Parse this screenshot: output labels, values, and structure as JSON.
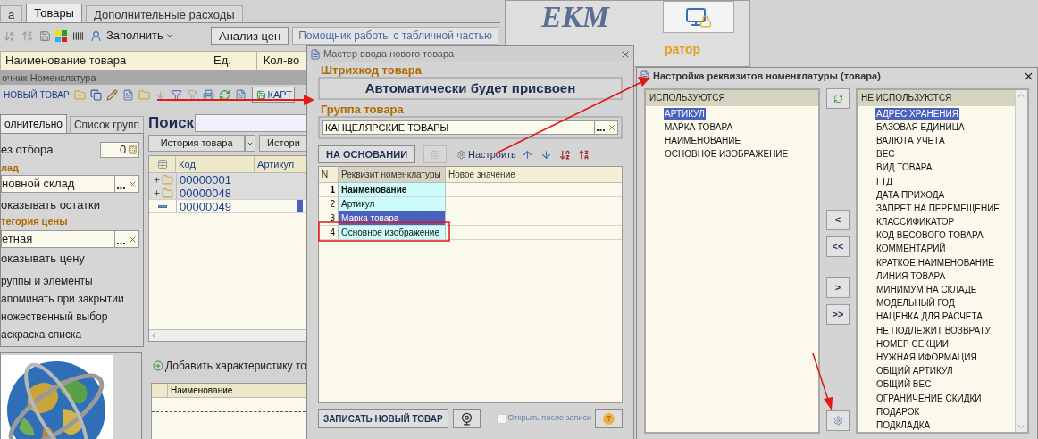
{
  "app": {
    "tabs": [
      {
        "label": "а",
        "selected": false
      },
      {
        "label": "Товары",
        "selected": true
      },
      {
        "label": "Дополнительные расходы",
        "selected": false
      }
    ],
    "fill_menu": "Заполнить",
    "buttons": [
      "Анализ цен",
      "Помощник работы с табличной частью"
    ],
    "logo": {
      "text": "ЕКМ",
      "caption": "ратор"
    },
    "goods_columns": [
      "Наименование товара",
      "Ед.",
      "Кол-во"
    ]
  },
  "catalog": {
    "title": "очник Номенклатура",
    "new_button": "НОВЫЙ ТОВАР",
    "card_button": "КАРТ",
    "tabs": [
      {
        "label": "олнительно",
        "selected": true
      },
      {
        "label": "Список групп",
        "selected": false
      }
    ],
    "no_filter": "ез отбора",
    "counter": "0",
    "warehouse": {
      "legend": "лад",
      "value": "новной склад"
    },
    "show_stock": "оказывать остатки",
    "price_category": {
      "legend": "тегория цены",
      "value": "етная"
    },
    "show_price": "оказывать цену",
    "options": [
      "руппы и элементы",
      "апоминать при закрытии",
      "ножественный выбор",
      "аскраска списка"
    ],
    "search_label": "Поиск",
    "history_buttons": [
      "История товара",
      "Истори"
    ],
    "columns": [
      "Код",
      "Артикул"
    ],
    "rows": [
      {
        "kind": "group",
        "code": "00000001",
        "selected": false
      },
      {
        "kind": "group",
        "code": "00000048",
        "selected": false
      },
      {
        "kind": "item",
        "code": "00000049",
        "selected": true
      }
    ],
    "add_characteristic": "Добавить характеристику то",
    "characteristic_columns": [
      "Наименование"
    ]
  },
  "wizard": {
    "title": "Мастер ввода нового товара",
    "barcode": {
      "legend": "Штрихкод товара",
      "value": "Автоматически будет присвоен"
    },
    "group": {
      "legend": "Группа товара",
      "value": "КАНЦЕЛЯРСКИЕ ТОВАРЫ"
    },
    "based_on_button": "НА ОСНОВАНИИ",
    "configure_button": "Настроить",
    "columns": [
      "N",
      "Реквизит номенклатуры",
      "Новое значение"
    ],
    "rows": [
      {
        "n": "1",
        "attribute": "Наименование",
        "required": true,
        "selected": false
      },
      {
        "n": "2",
        "attribute": "Артикул",
        "required": false,
        "selected": false
      },
      {
        "n": "3",
        "attribute": "Марка товара",
        "required": false,
        "selected": true
      },
      {
        "n": "4",
        "attribute": "Основное изображение",
        "required": false,
        "selected": false
      }
    ],
    "save_button": "ЗАПИСАТЬ НОВЫЙ ТОВАР",
    "help_button": "?",
    "open_after_save": {
      "label": "Открыть после записи",
      "checked": false
    }
  },
  "settings": {
    "title": "Настройка реквизитов номенклатуры (товара)",
    "used": {
      "header": "ИСПОЛЬЗУЮТСЯ",
      "items": [
        {
          "label": "АРТИКУЛ",
          "selected": true
        },
        {
          "label": "МАРКА ТОВАРА",
          "selected": false
        },
        {
          "label": "НАИМЕНОВАНИЕ",
          "selected": false
        },
        {
          "label": "ОСНОВНОЕ ИЗОБРАЖЕНИЕ",
          "selected": false
        }
      ]
    },
    "move_buttons": [
      "<",
      "<<",
      ">",
      ">>"
    ],
    "unused": {
      "header": "НЕ ИСПОЛЬЗУЮТСЯ",
      "items": [
        {
          "label": "АДРЕС ХРАНЕНИЯ",
          "selected": true
        },
        {
          "label": "БАЗОВАЯ ЕДИНИЦА",
          "selected": false
        },
        {
          "label": "ВАЛЮТА УЧЕТА",
          "selected": false
        },
        {
          "label": "ВЕС",
          "selected": false
        },
        {
          "label": "ВИД ТОВАРА",
          "selected": false
        },
        {
          "label": "ГТД",
          "selected": false
        },
        {
          "label": "ДАТА ПРИХОДА",
          "selected": false
        },
        {
          "label": "ЗАПРЕТ НА ПЕРЕМЕЩЕНИЕ",
          "selected": false
        },
        {
          "label": "КЛАССИФИКАТОР",
          "selected": false
        },
        {
          "label": "КОД ВЕСОВОГО ТОВАРА",
          "selected": false
        },
        {
          "label": "КОММЕНТАРИЙ",
          "selected": false
        },
        {
          "label": "КРАТКОЕ НАИМЕНОВАНИЕ",
          "selected": false
        },
        {
          "label": "ЛИНИЯ ТОВАРА",
          "selected": false
        },
        {
          "label": "МИНИМУМ НА СКЛАДЕ",
          "selected": false
        },
        {
          "label": "МОДЕЛЬНЫЙ ГОД",
          "selected": false
        },
        {
          "label": "НАЦЕНКА ДЛЯ РАСЧЕТА",
          "selected": false
        },
        {
          "label": "НЕ ПОДЛЕЖИТ ВОЗВРАТУ",
          "selected": false
        },
        {
          "label": "НОМЕР СЕКЦИИ",
          "selected": false
        },
        {
          "label": "НУЖНАЯ ИФОРМАЦИЯ",
          "selected": false
        },
        {
          "label": "ОБЩИЙ АРТИКУЛ",
          "selected": false
        },
        {
          "label": "ОБЩИЙ ВЕС",
          "selected": false
        },
        {
          "label": "ОГРАНИЧЕНИЕ СКИДКИ",
          "selected": false
        },
        {
          "label": "ПОДАРОК",
          "selected": false
        },
        {
          "label": "ПОДКЛАДКА",
          "selected": false
        }
      ]
    }
  }
}
